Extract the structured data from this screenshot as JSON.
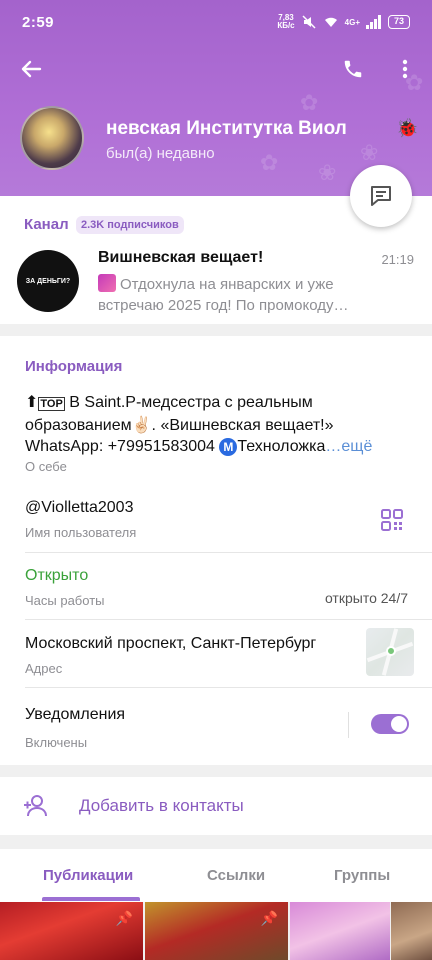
{
  "status_bar": {
    "time": "2:59",
    "speed_value": "7,83",
    "speed_unit": "КБ/с",
    "network": "4G+",
    "battery": "73"
  },
  "profile": {
    "name": "невская    Институтка Виол",
    "last_seen": "был(а) недавно"
  },
  "channel": {
    "label": "Канал",
    "subscribers": "2.3K подписчиков",
    "avatar_text": "ЗА ДЕНЬГИ?",
    "title": "Вишневская вещает!",
    "time": "21:19",
    "preview": "Отдохнула на январских и уже встречаю 2025 год!  По промокоду…"
  },
  "info": {
    "header": "Информация",
    "bio_top_badge": "TOP",
    "bio_line1": " В Saint.P-медсестра с реальным образованием✌🏻. «Вишневская вещает!» WhatsApp: +79951583004 ",
    "bio_m_badge": "M",
    "bio_line2": "Техноложка",
    "bio_more": "…ещё",
    "bio_label": "О себе",
    "username": "@Violletta2003",
    "username_label": "Имя пользователя",
    "open_status": "Открыто",
    "hours_label": "Часы работы",
    "hours_value": "открыто 24/7",
    "address": "Московский проспект, Санкт-Петербург",
    "address_label": "Адрес",
    "notifications": "Уведомления",
    "notifications_state": "Включены",
    "notifications_enabled": true
  },
  "add_contact": {
    "label": "Добавить в контакты"
  },
  "tabs": [
    {
      "label": "Публикации",
      "active": true
    },
    {
      "label": "Ссылки",
      "active": false
    },
    {
      "label": "Группы",
      "active": false
    }
  ],
  "colors": {
    "accent": "#8a5cc0",
    "header_bg": "#b06fd6",
    "open_green": "#3aa23a"
  },
  "icons": {
    "back": "arrow-left-icon",
    "call": "phone-icon",
    "menu": "more-vertical-icon",
    "message": "message-icon",
    "qr": "qr-code-icon",
    "add_contact": "person-add-icon",
    "pin": "pin-icon"
  }
}
